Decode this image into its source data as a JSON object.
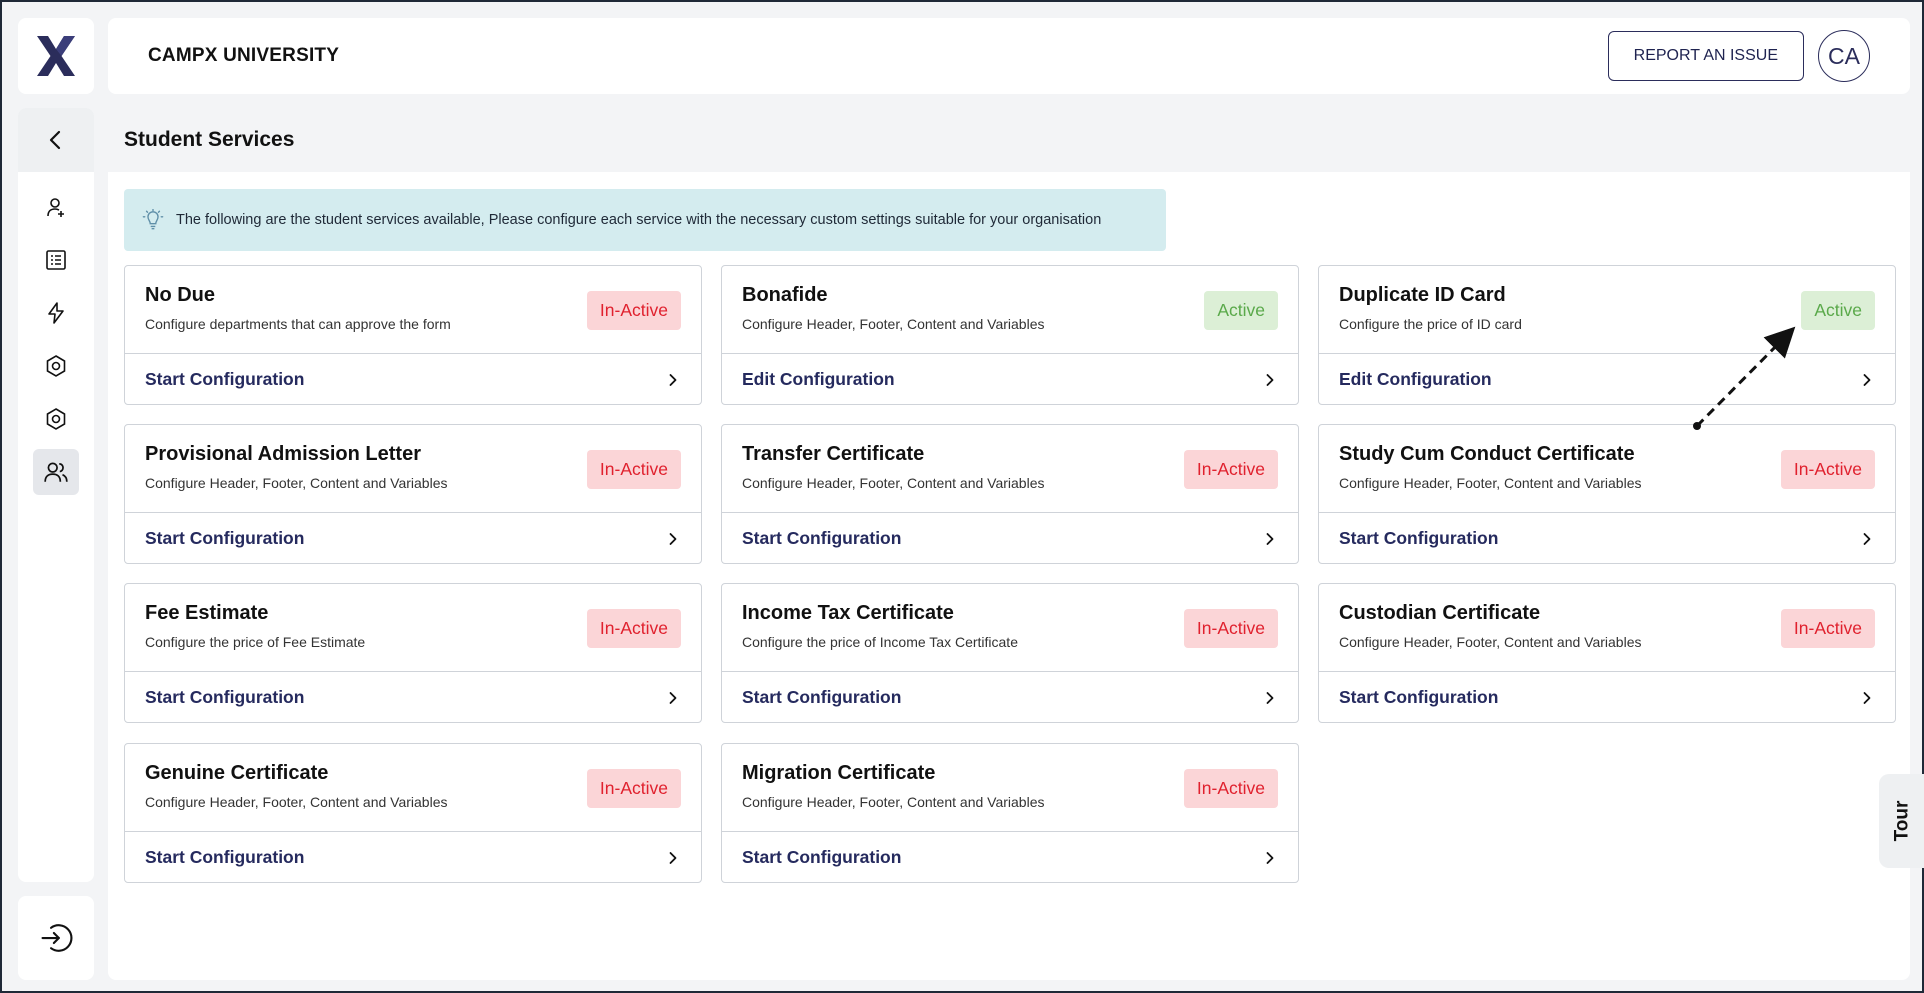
{
  "app": {
    "logo_icon": "campx-x-logo",
    "org_name": "CAMPX UNIVERSITY",
    "report_button": "REPORT AN ISSUE",
    "avatar_initials": "CA",
    "brand_color": "#2b2d5b"
  },
  "sidebar": {
    "back_icon": "chevron-left-icon",
    "items": [
      {
        "icon": "user-add-icon"
      },
      {
        "icon": "document-list-icon"
      },
      {
        "icon": "lightning-icon"
      },
      {
        "icon": "settings-gear-icon"
      },
      {
        "icon": "settings-gear-icon"
      },
      {
        "icon": "users-group-icon",
        "active": true
      }
    ],
    "logout_icon": "logout-icon"
  },
  "page": {
    "title": "Student Services",
    "info_icon": "lightbulb-icon",
    "info_text": "The following are the student services available, Please configure each service with the necessary custom settings suitable for your organisation"
  },
  "services": [
    {
      "title": "No Due",
      "subtitle": "Configure departments that can approve the form",
      "status": "In-Active",
      "action": "Start Configuration"
    },
    {
      "title": "Bonafide",
      "subtitle": "Configure Header, Footer, Content and Variables",
      "status": "Active",
      "action": "Edit Configuration"
    },
    {
      "title": "Duplicate ID Card",
      "subtitle": "Configure the price of ID card",
      "status": "Active",
      "action": "Edit Configuration"
    },
    {
      "title": "Provisional Admission Letter",
      "subtitle": "Configure Header, Footer, Content and Variables",
      "status": "In-Active",
      "action": "Start Configuration"
    },
    {
      "title": "Transfer Certificate",
      "subtitle": "Configure Header, Footer, Content and Variables",
      "status": "In-Active",
      "action": "Start Configuration"
    },
    {
      "title": "Study Cum Conduct Certificate",
      "subtitle": "Configure Header, Footer, Content and Variables",
      "status": "In-Active",
      "action": "Start Configuration"
    },
    {
      "title": "Fee Estimate",
      "subtitle": "Configure the price of Fee Estimate",
      "status": "In-Active",
      "action": "Start Configuration"
    },
    {
      "title": "Income Tax Certificate",
      "subtitle": "Configure the price of Income Tax Certificate",
      "status": "In-Active",
      "action": "Start Configuration"
    },
    {
      "title": "Custodian Certificate",
      "subtitle": "Configure Header, Footer, Content and Variables",
      "status": "In-Active",
      "action": "Start Configuration"
    },
    {
      "title": "Genuine Certificate",
      "subtitle": "Configure Header, Footer, Content and Variables",
      "status": "In-Active",
      "action": "Start Configuration"
    },
    {
      "title": "Migration Certificate",
      "subtitle": "Configure Header, Footer, Content and Variables",
      "status": "In-Active",
      "action": "Start Configuration"
    }
  ],
  "tour": {
    "label": "Tour"
  },
  "status_colors": {
    "active_bg": "#dcefd6",
    "active_text": "#5aa94a",
    "inactive_bg": "#fbd5d7",
    "inactive_text": "#e0212e"
  }
}
